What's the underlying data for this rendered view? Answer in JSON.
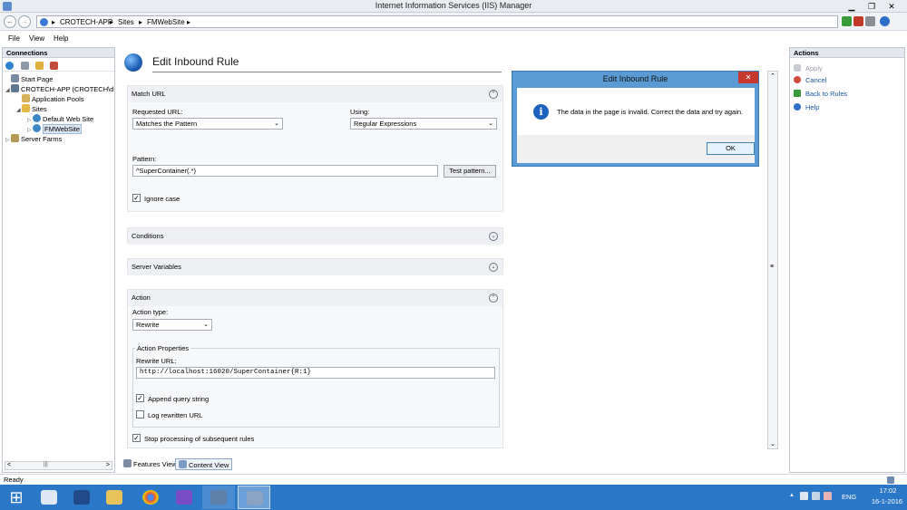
{
  "window": {
    "title": "Internet Information Services (IIS) Manager",
    "buttons": {
      "minimize": "▁",
      "maximize": "❐",
      "close": "✕"
    }
  },
  "address": {
    "back": "←",
    "forward": "→",
    "crumbs": [
      "▸",
      "CROTECH-APP",
      "▸",
      "Sites",
      "▸",
      "FMWebSite",
      "▸"
    ]
  },
  "menu": [
    "File",
    "View",
    "Help"
  ],
  "connections": {
    "title": "Connections",
    "tree": [
      {
        "label": "Start Page",
        "exp": ""
      },
      {
        "label": "CROTECH-APP (CROTECH\\d",
        "exp": "◢"
      },
      {
        "label": "Application Pools",
        "exp": ""
      },
      {
        "label": "Sites",
        "exp": "◢"
      },
      {
        "label": "Default Web Site",
        "exp": "▷"
      },
      {
        "label": "FMWebSite",
        "exp": "▷"
      },
      {
        "label": "Server Farms",
        "exp": "▷"
      }
    ],
    "scroll_left": "<",
    "scroll_thumb": "|||",
    "scroll_right": ">"
  },
  "main": {
    "title": "Edit Inbound Rule",
    "match_url": {
      "header": "Match URL",
      "requested_url_label": "Requested URL:",
      "requested_url_value": "Matches the Pattern",
      "using_label": "Using:",
      "using_value": "Regular Expressions",
      "pattern_label": "Pattern:",
      "pattern_value": "^SuperContainer(.*)",
      "test_button": "Test pattern...",
      "ignore_case_label": "Ignore case",
      "ignore_case": true
    },
    "conditions": {
      "header": "Conditions"
    },
    "server_variables": {
      "header": "Server Variables"
    },
    "action": {
      "header": "Action",
      "action_type_label": "Action type:",
      "action_type_value": "Rewrite",
      "properties_label": "Action Properties",
      "rewrite_url_label": "Rewrite URL:",
      "rewrite_url_value": "http://localhost:16020/SuperContainer{R:1}",
      "append_query_label": "Append query string",
      "append_query": true,
      "log_rewritten_label": "Log rewritten URL",
      "log_rewritten": false,
      "stop_processing_label": "Stop processing of subsequent rules",
      "stop_processing": true
    },
    "view_tabs": [
      "Features View",
      "Content View"
    ]
  },
  "actions": {
    "title": "Actions",
    "items": [
      {
        "label": "Apply",
        "disabled": true
      },
      {
        "label": "Cancel",
        "disabled": false
      },
      {
        "label": "Back to Rules",
        "disabled": false
      },
      {
        "label": "Help",
        "disabled": false
      }
    ]
  },
  "dialog": {
    "title": "Edit Inbound Rule",
    "close": "✕",
    "icon": "i",
    "message": "The data in the page is invalid. Correct the data and try again.",
    "ok": "OK"
  },
  "status": {
    "text": "Ready"
  },
  "taskbar": {
    "start": "⊞",
    "apps": [
      "file-explorer-icon",
      "powershell-icon",
      "folder-icon",
      "chrome-icon",
      "visual-studio-icon",
      "remote-desktop-icon",
      "iis-manager-icon"
    ],
    "tray": {
      "arrow": "▲",
      "language": "ENG",
      "time": "17:02",
      "date": "16-1-2016"
    }
  },
  "colors": {
    "taskbar": "#2b78c8",
    "dialog_frame": "#5b9bd5",
    "info_icon": "#1f63c1",
    "close_red": "#c9382e"
  }
}
